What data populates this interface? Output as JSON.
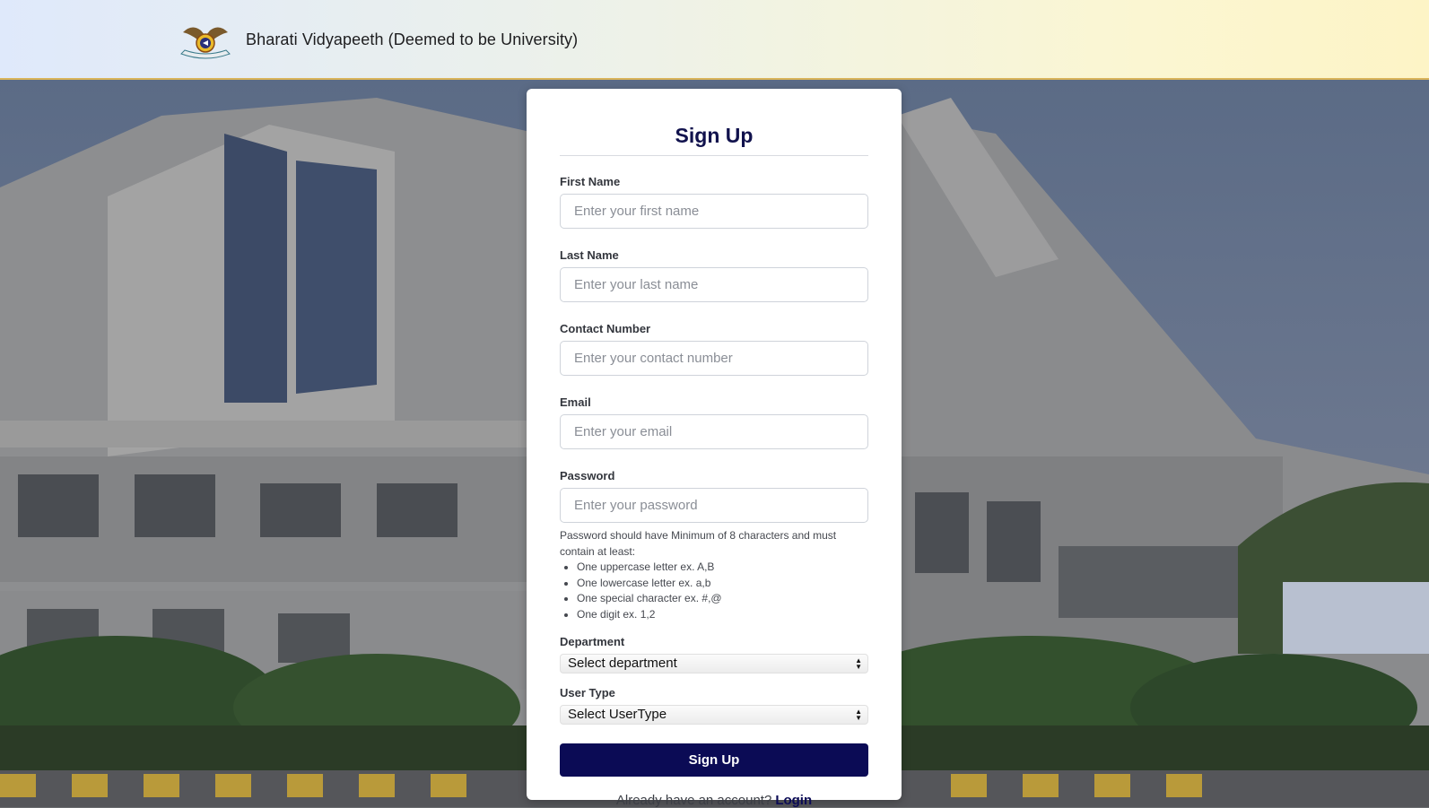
{
  "header": {
    "brand": "Bharati Vidyapeeth (Deemed to be University)",
    "logo_icon": "university-emblem-icon"
  },
  "form": {
    "title": "Sign Up",
    "first_name": {
      "label": "First Name",
      "placeholder": "Enter your first name"
    },
    "last_name": {
      "label": "Last Name",
      "placeholder": "Enter your last name"
    },
    "contact": {
      "label": "Contact Number",
      "placeholder": "Enter your contact number"
    },
    "email": {
      "label": "Email",
      "placeholder": "Enter your email"
    },
    "password": {
      "label": "Password",
      "placeholder": "Enter your password"
    },
    "password_hint": {
      "intro": "Password should have Minimum of 8 characters and must contain at least:",
      "rules": [
        "One uppercase letter ex. A,B",
        "One lowercase letter ex. a,b",
        "One special character ex. #,@",
        "One digit ex. 1,2"
      ]
    },
    "department": {
      "label": "Department",
      "selected": "Select department"
    },
    "user_type": {
      "label": "User Type",
      "selected": "Select UserType"
    },
    "submit_label": "Sign Up",
    "login_prompt": "Already have an account?",
    "login_link": "Login"
  },
  "colors": {
    "accent": "#0b0b55",
    "title": "#11124d",
    "header_border": "#d9b45a"
  }
}
